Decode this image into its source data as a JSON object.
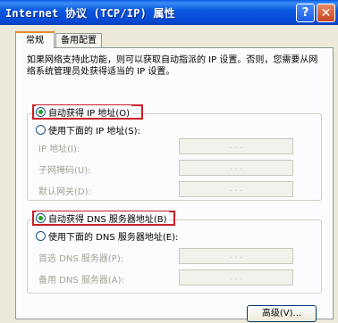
{
  "window": {
    "title": "Internet 协议 (TCP/IP) 属性",
    "help_label": "?",
    "close_label": "✕"
  },
  "tabs": [
    "常规",
    "备用配置"
  ],
  "description": "如果网络支持此功能，则可以获取自动指派的 IP 设置。否则，您需要从网络系统管理员处获得适当的 IP 设置。",
  "ip_section": {
    "auto_label": "自动获得 IP 地址(O)",
    "manual_label": "使用下面的 IP 地址(S):",
    "auto_selected": true,
    "fields": [
      {
        "label": "IP 地址(I):",
        "value": ".   .   ."
      },
      {
        "label": "子网掩码(U):",
        "value": ".   .   ."
      },
      {
        "label": "默认网关(D):",
        "value": ".   .   ."
      }
    ]
  },
  "dns_section": {
    "auto_label": "自动获得 DNS 服务器地址(B)",
    "manual_label": "使用下面的 DNS 服务器地址(E):",
    "auto_selected": true,
    "fields": [
      {
        "label": "首选 DNS 服务器(P):",
        "value": ".   .   ."
      },
      {
        "label": "备用 DNS 服务器(A):",
        "value": ".   .   ."
      }
    ]
  },
  "advanced_button": "高级(V)...",
  "colors": {
    "titlebar": "#0a58e0",
    "highlight_box": "#c8202a",
    "radio_dot": "#21a121",
    "background": "#ece9d8"
  }
}
